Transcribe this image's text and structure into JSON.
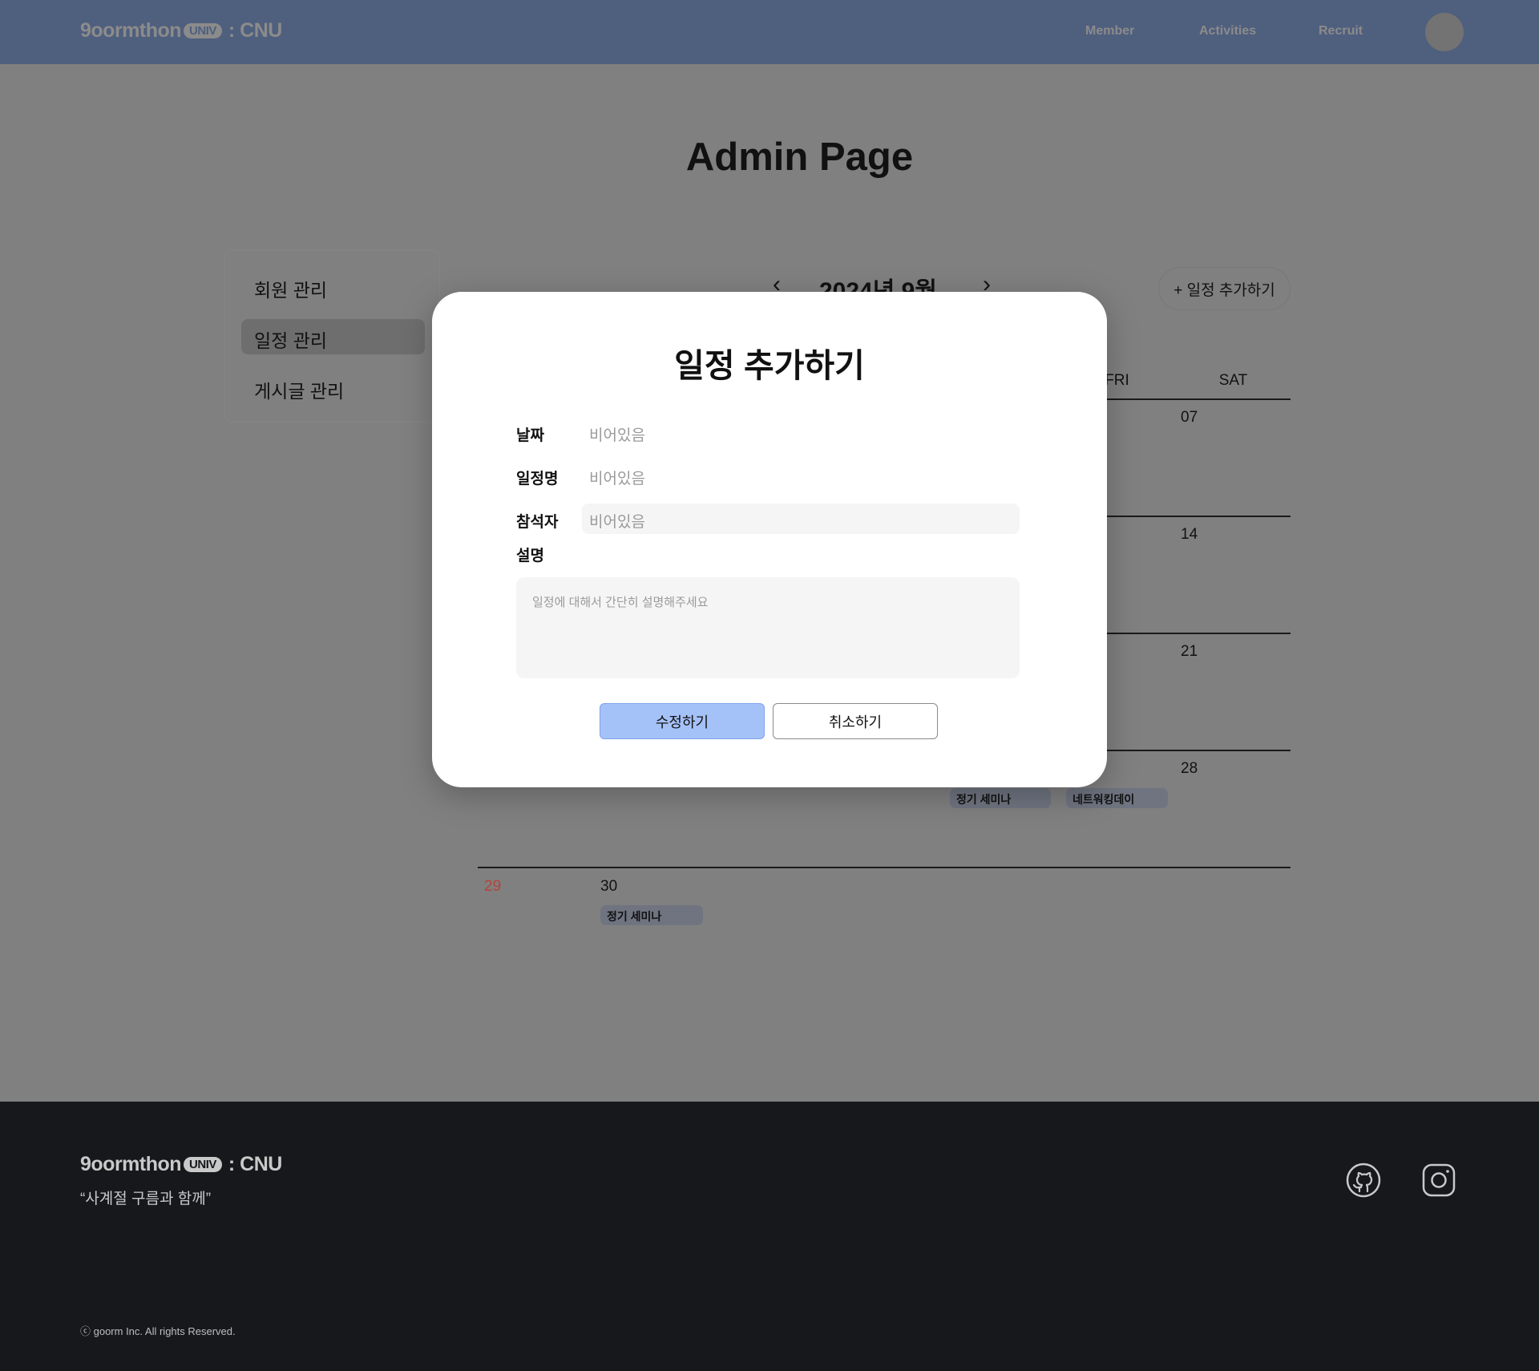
{
  "header": {
    "logo": {
      "name": "9oormthon",
      "badge": "UNIV",
      "suffix": ": CNU"
    },
    "nav": [
      "Member",
      "Activities",
      "Recruit"
    ]
  },
  "page_title": "Admin Page",
  "sidebar": {
    "items": [
      {
        "label": "회원 관리",
        "active": false
      },
      {
        "label": "일정 관리",
        "active": true
      },
      {
        "label": "게시글 관리",
        "active": false
      }
    ]
  },
  "calendar": {
    "title": "2024년 9월",
    "prev_icon": "chevron-left-icon",
    "next_icon": "chevron-right-icon",
    "add_button": "+ 일정 추가하기",
    "weekday_headers_visible": [
      "FRI",
      "SAT"
    ],
    "visible_days": {
      "sat": [
        "07",
        "14",
        "21",
        "28"
      ],
      "row5": [
        "29",
        "30"
      ]
    },
    "events": [
      {
        "day": "26",
        "label": "정기 세미나"
      },
      {
        "day": "27",
        "label": "네트워킹데이"
      },
      {
        "day": "30",
        "label": "정기 세미나"
      }
    ],
    "sunday_color": "#b3453a"
  },
  "modal": {
    "title": "일정 추가하기",
    "fields": {
      "date": {
        "label": "날짜",
        "value": "비어있음"
      },
      "name": {
        "label": "일정명",
        "value": "비어있음"
      },
      "attendees": {
        "label": "참석자",
        "value": "비어있음"
      },
      "description": {
        "label": "설명",
        "placeholder": "일정에 대해서 간단히 설명해주세요"
      }
    },
    "save_button": "수정하기",
    "cancel_button": "취소하기",
    "accent": "#a5c2f8"
  },
  "footer": {
    "logo": {
      "name": "9oormthon",
      "badge": "UNIV",
      "suffix": ": CNU"
    },
    "tagline": "“사계절 구름과 함께”",
    "copyright": "ⓒ goorm Inc. All rights Reserved.",
    "social": [
      "github-icon",
      "instagram-icon"
    ]
  }
}
